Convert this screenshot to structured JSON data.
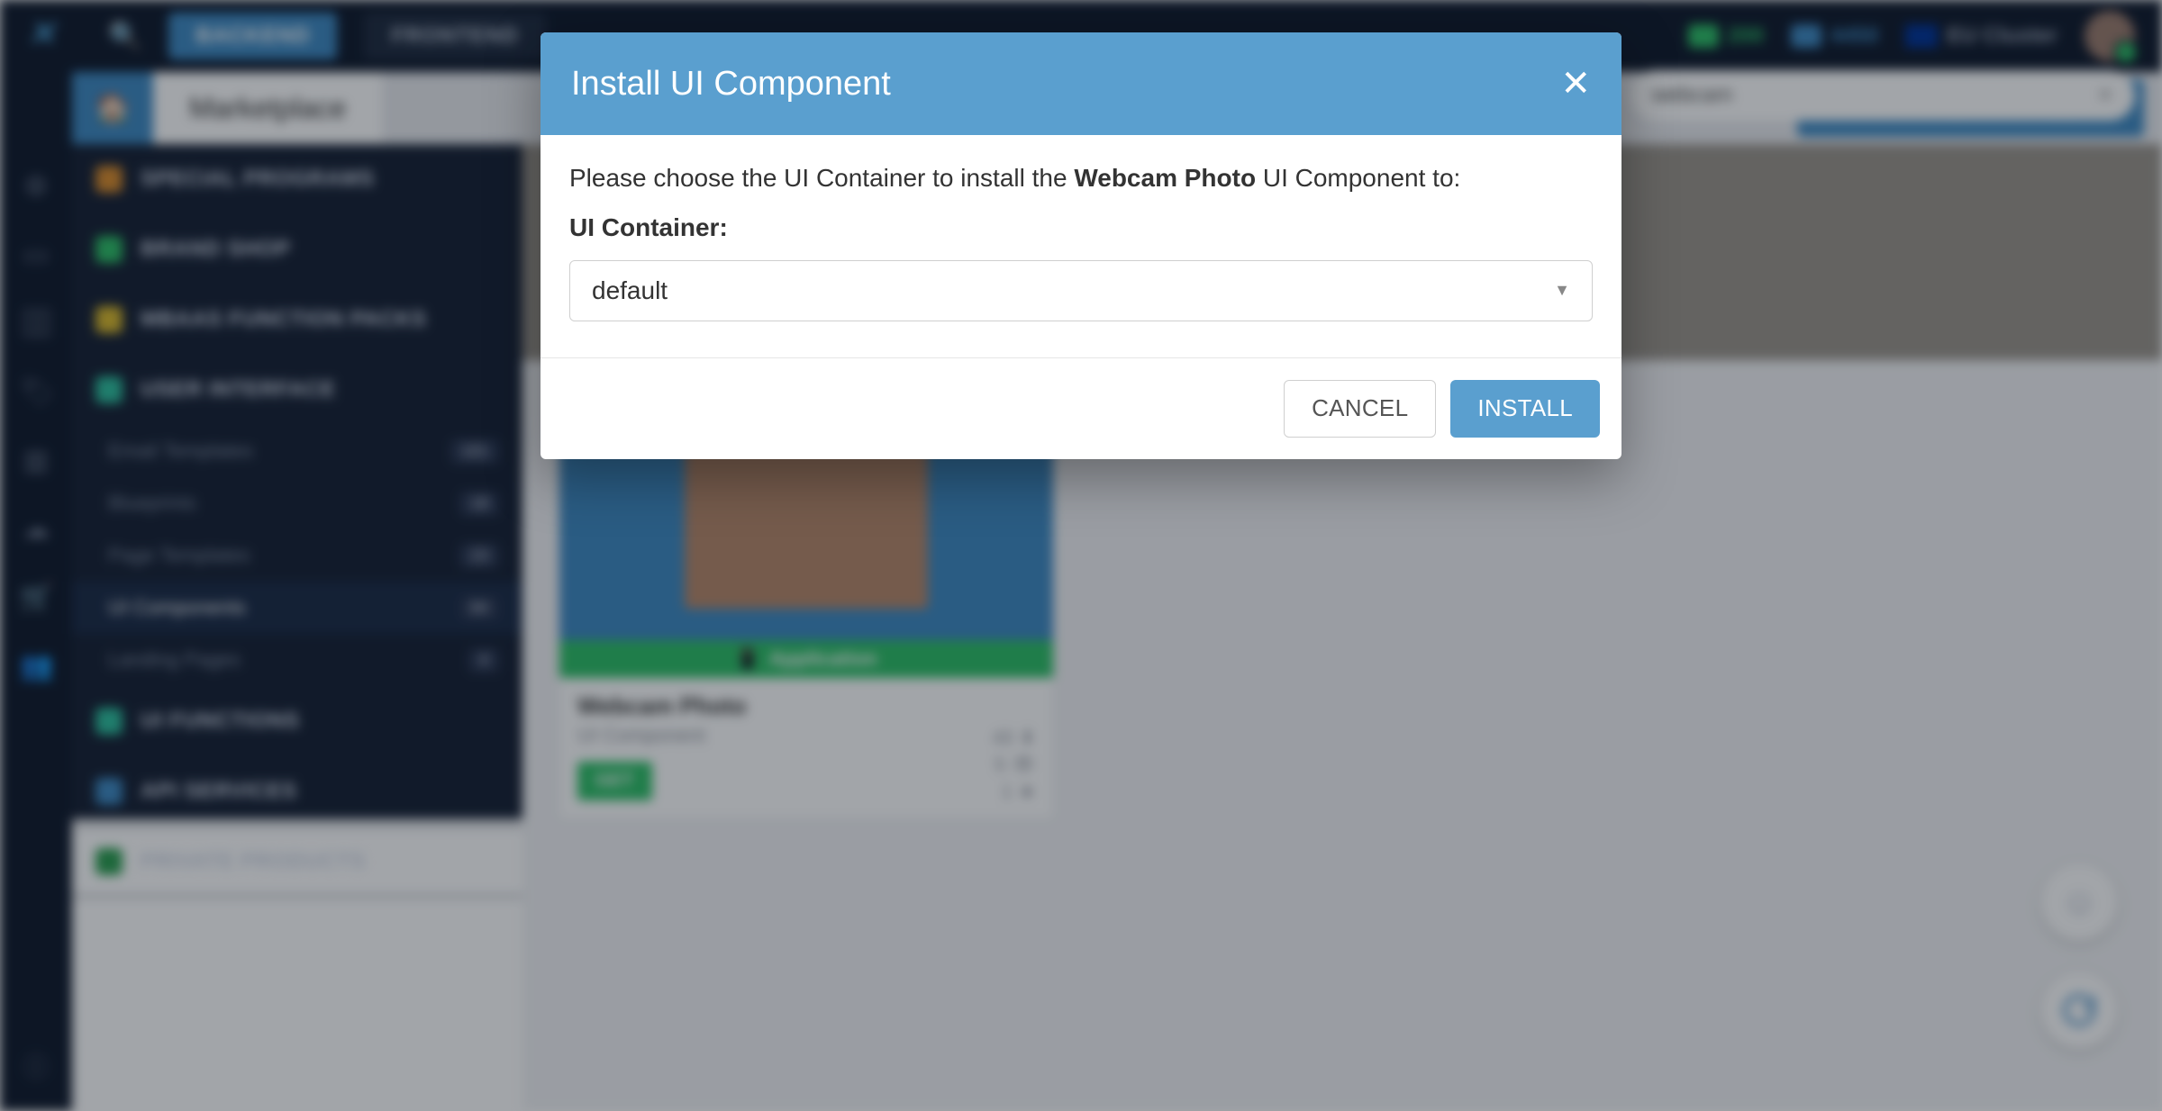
{
  "top": {
    "backend_label": "BACKEND",
    "frontend_label": "FRONTEND",
    "stat_green": "200",
    "stat_blue": "4450",
    "cluster_label": "EU Cluster"
  },
  "tabs": {
    "page_title": "Marketplace",
    "app_switcher": "CustomComponentsApp"
  },
  "search": {
    "value": "webcam"
  },
  "sidebar": {
    "categories": {
      "special": "SPECIAL PROGRAMS",
      "brand": "BRAND SHOP",
      "mbaas": "MBAAS FUNCTION PACKS",
      "ui": "USER INTERFACE",
      "uifunc": "UI FUNCTIONS",
      "api": "API SERVICES",
      "private": "PRIVATE PRODUCTS"
    },
    "ui_items": [
      {
        "label": "Email Templates",
        "count": "101"
      },
      {
        "label": "Blueprints",
        "count": "18"
      },
      {
        "label": "Page Templates",
        "count": "23"
      },
      {
        "label": "UI Components",
        "count": "84"
      },
      {
        "label": "Landing Pages",
        "count": "4"
      }
    ]
  },
  "card": {
    "strip": "Application",
    "title": "Webcam Photo",
    "type": "UI Component",
    "downloads": "43",
    "views": "5",
    "stars": "1",
    "get": "GET"
  },
  "modal": {
    "title": "Install UI Component",
    "body_pre": "Please choose the UI Container to install the ",
    "body_component": "Webcam Photo",
    "body_post": " UI Component to:",
    "field_label": "UI Container:",
    "select_value": "default",
    "cancel": "CANCEL",
    "install": "INSTALL"
  }
}
